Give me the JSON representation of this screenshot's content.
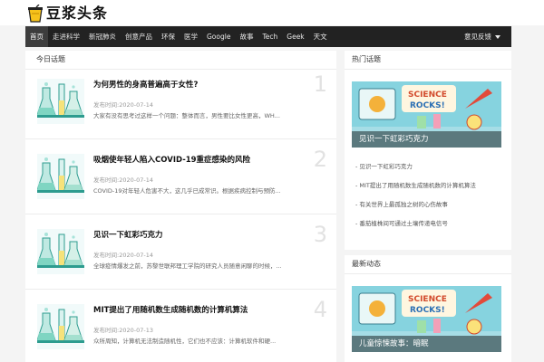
{
  "brand": {
    "name": "豆浆头条"
  },
  "nav": {
    "items": [
      "首页",
      "走进科学",
      "新冠肺炎",
      "创意产品",
      "环保",
      "医学",
      "Google",
      "故事",
      "Tech",
      "Geek",
      "天文"
    ],
    "active_index": 0,
    "feedback_label": "意见反馈"
  },
  "main": {
    "section_title": "今日话题",
    "date_prefix": "发布时间:",
    "articles": [
      {
        "title": "为何男性的身高普遍高于女性?",
        "date": "2020-07-14",
        "summary": "大家有没有思考过这样一个问题：整体而言，男性要比女性更高，WH...",
        "num": "1"
      },
      {
        "title": "吸烟使年轻人陷入COVID-19重症感染的风险",
        "date": "2020-07-14",
        "summary": "COVID-19对年轻人危害不大，这几乎已成常识。根据疾病控制与预防...",
        "num": "2"
      },
      {
        "title": "见识一下虹彩巧克力",
        "date": "2020-07-14",
        "summary": "全球疫情爆发之前，苏黎世联邦理工学院的研究人员随意闲聊的时候，...",
        "num": "3"
      },
      {
        "title": "MIT提出了用随机数生成随机数的计算机算法",
        "date": "2020-07-13",
        "summary": "众所周知，计算机无法制造随机性，它们也不应该：计算机软件和硬...",
        "num": "4"
      }
    ]
  },
  "sidebar": {
    "hot_title": "热门话题",
    "hot_hero_caption": "见识一下虹彩巧克力",
    "hot_items": [
      "- 见识一下虹彩巧克力",
      "- MIT提出了用随机数生成随机数的计算机算法",
      "- 有关世界上最孤独之树的心伤故事",
      "- 番茄植株间可通过土壤传递电信号"
    ],
    "latest_title": "最新动态",
    "latest_hero_caption": "儿童惊悚故事：暗眠"
  }
}
